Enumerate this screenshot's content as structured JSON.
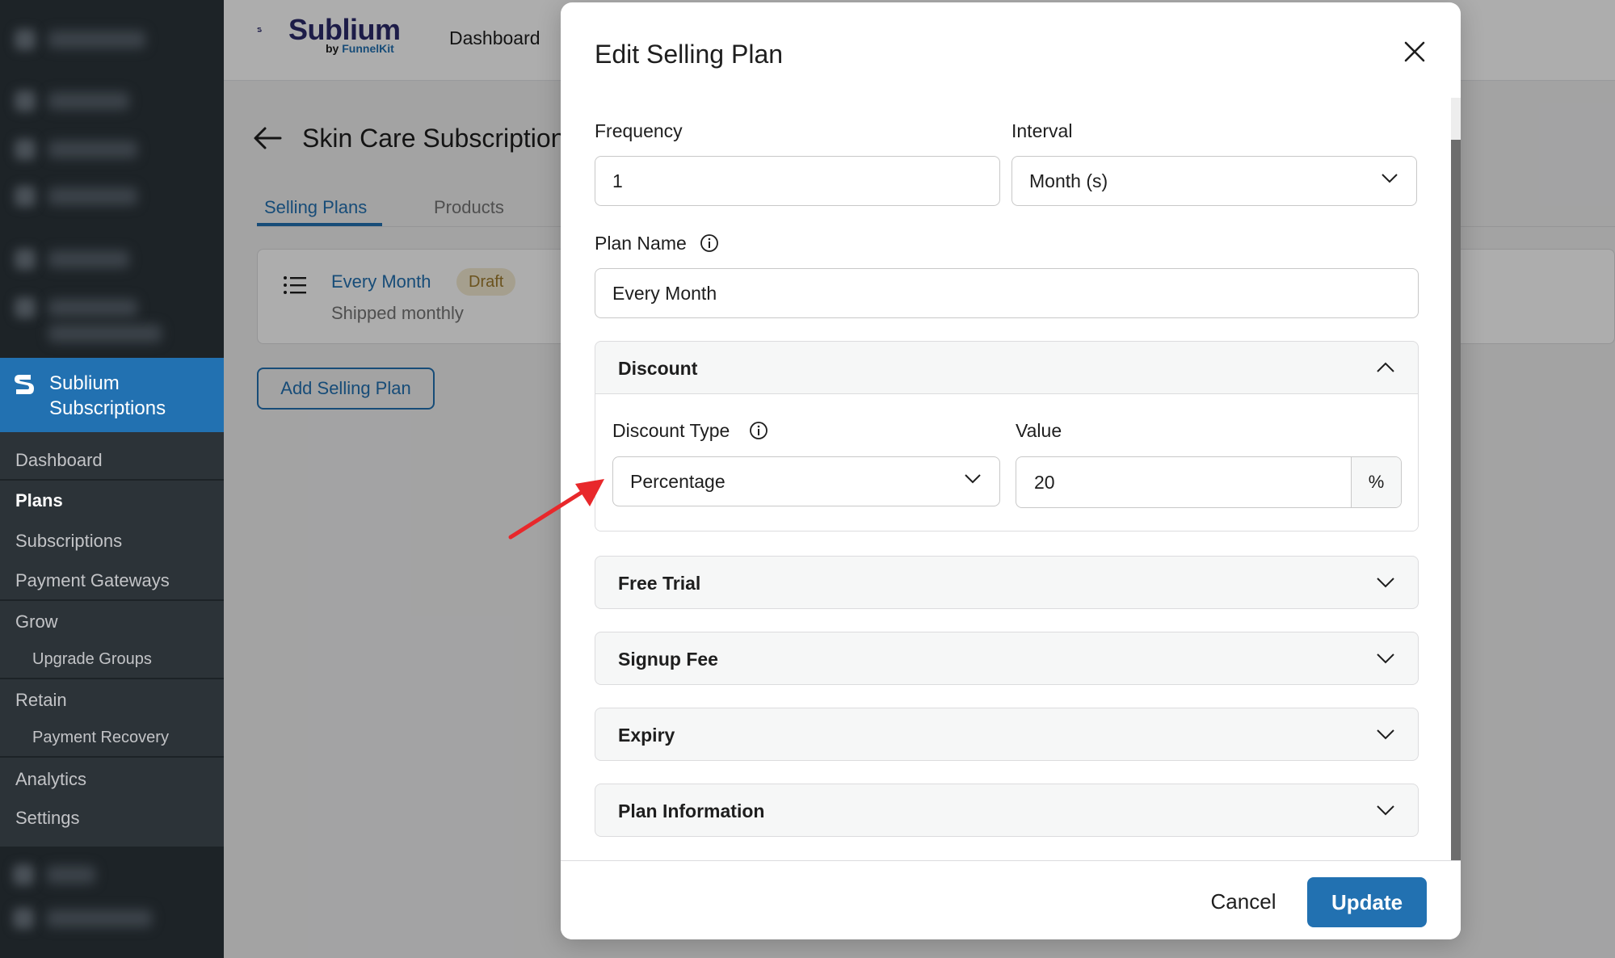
{
  "sidebar": {
    "current_menu": "Sublium Subscriptions",
    "items": [
      {
        "label": "Dashboard",
        "active": false,
        "sub": false
      },
      {
        "label": "Plans",
        "active": true,
        "sub": false
      },
      {
        "label": "Subscriptions",
        "active": false,
        "sub": false
      },
      {
        "label": "Payment Gateways",
        "active": false,
        "sub": false
      },
      {
        "label": "Grow",
        "active": false,
        "sub": false
      },
      {
        "label": "Upgrade Groups",
        "active": false,
        "sub": true
      },
      {
        "label": "Retain",
        "active": false,
        "sub": false
      },
      {
        "label": "Payment Recovery",
        "active": false,
        "sub": true
      },
      {
        "label": "Analytics",
        "active": false,
        "sub": false
      },
      {
        "label": "Settings",
        "active": false,
        "sub": false
      }
    ]
  },
  "header": {
    "brand": "Sublium",
    "brand_by": "by ",
    "brand_by_strong": "FunnelKit",
    "nav_dashboard": "Dashboard"
  },
  "page": {
    "title": "Skin Care Subscription",
    "tabs": [
      "Selling Plans",
      "Products"
    ],
    "active_tab": "Selling Plans",
    "plan_card": {
      "name": "Every Month",
      "badge": "Draft",
      "subtitle": "Shipped monthly"
    },
    "add_button": "Add Selling Plan"
  },
  "modal": {
    "title": "Edit Selling Plan",
    "frequency": {
      "label": "Frequency",
      "value": "1"
    },
    "interval": {
      "label": "Interval",
      "value": "Month (s)"
    },
    "plan_name": {
      "label": "Plan Name",
      "value": "Every Month"
    },
    "discount": {
      "title": "Discount",
      "expanded": true,
      "type_label": "Discount Type",
      "type_value": "Percentage",
      "value_label": "Value",
      "value": "20",
      "unit": "%"
    },
    "sections": [
      {
        "title": "Free Trial"
      },
      {
        "title": "Signup Fee"
      },
      {
        "title": "Expiry"
      },
      {
        "title": "Plan Information"
      }
    ],
    "cancel": "Cancel",
    "update": "Update"
  },
  "colors": {
    "primary": "#2271b1",
    "sidebar": "#1d2327",
    "annotation_arrow": "#e8282b"
  }
}
